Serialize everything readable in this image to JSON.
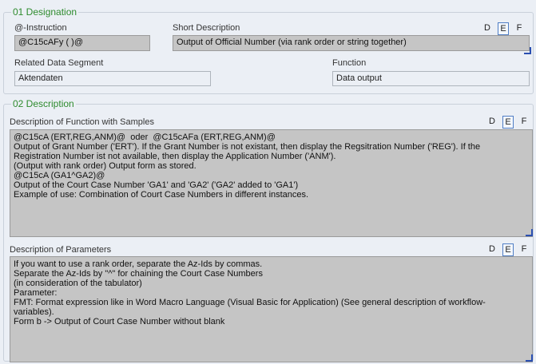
{
  "designation": {
    "title": "01 Designation",
    "instruction_label": "@-Instruction",
    "instruction_value": "@C15cAFy ( )@",
    "short_desc_label": "Short Description",
    "short_desc_value": "Output of Official Number (via rank order or string together)",
    "segment_label": "Related Data Segment",
    "segment_value": "Aktendaten",
    "function_label": "Function",
    "function_value": "Data output"
  },
  "languages": [
    "D",
    "E",
    "F"
  ],
  "active_language": "E",
  "description": {
    "title": "02 Description",
    "function_label": "Description of Function with Samples",
    "function_lines": [
      "@C15cA (ERT,REG,ANM)@  oder  @C15cAFa (ERT,REG,ANM)@",
      "Output of Grant Number ('ERT'). If the Grant Number is not existant, then display the Regsitration Number ('REG'). If the",
      "Registration Number ist not available, then display the Application Number ('ANM').",
      "(Output with rank order) Output form as stored.",
      "",
      "@C15cA (GA1^GA2)@",
      "Output of the Court Case Number 'GA1' and 'GA2' ('GA2' added to 'GA1')",
      "Example of use: Combination of Court Case Numbers in different instances."
    ],
    "params_label": "Description of Parameters",
    "params_lines": [
      "If you want to use a rank order, separate the Az-Ids by commas.",
      "Separate the Az-Ids by \"^\" for chaining the Court Case Numbers",
      "(in consideration of the tabulator)",
      "",
      "Parameter:",
      "FMT: Format expression like in Word Macro Language (Visual Basic for Application) (See general description of workflow-",
      "variables).",
      "",
      "Form b -> Output of Court Case Number without blank"
    ]
  }
}
